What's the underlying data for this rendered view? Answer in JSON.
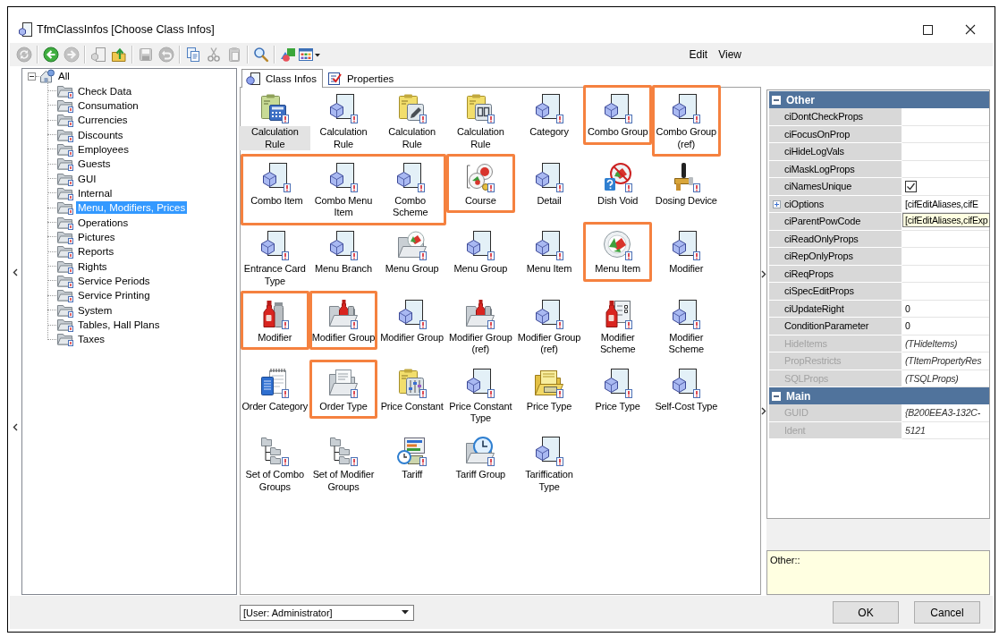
{
  "window": {
    "title": "TfmClassInfos [Choose Class Infos]"
  },
  "toolbar": [
    {
      "buttons": [
        {
          "kind": "refresh",
          "disabled": true
        }
      ]
    },
    {
      "buttons": [
        {
          "kind": "back",
          "disabled": false
        },
        {
          "kind": "forward",
          "disabled": true
        }
      ]
    },
    {
      "buttons": [
        {
          "kind": "document",
          "disabled": true
        },
        {
          "kind": "folderup",
          "disabled": false
        }
      ]
    },
    {
      "buttons": [
        {
          "kind": "save",
          "disabled": true
        },
        {
          "kind": "undo",
          "disabled": true
        }
      ]
    },
    {
      "buttons": [
        {
          "kind": "copy",
          "disabled": false
        },
        {
          "kind": "cut",
          "disabled": true
        },
        {
          "kind": "paste",
          "disabled": true
        }
      ]
    },
    {
      "buttons": [
        {
          "kind": "search",
          "disabled": false
        }
      ]
    },
    {
      "buttons": [
        {
          "kind": "shapes",
          "disabled": false
        },
        {
          "kind": "grid",
          "disabled": false
        }
      ]
    }
  ],
  "menu": [
    "Edit",
    "View"
  ],
  "tree": {
    "label": "All",
    "expanded": true,
    "selected": false,
    "children": [
      {
        "label": "Check Data",
        "selected": false
      },
      {
        "label": "Consumation",
        "selected": false
      },
      {
        "label": "Currencies",
        "selected": false
      },
      {
        "label": "Discounts",
        "selected": false
      },
      {
        "label": "Employees",
        "selected": false
      },
      {
        "label": "Guests",
        "selected": false
      },
      {
        "label": "GUI",
        "selected": false
      },
      {
        "label": "Internal",
        "selected": false
      },
      {
        "label": "Menu, Modifiers, Prices",
        "selected": true
      },
      {
        "label": "Operations",
        "selected": false
      },
      {
        "label": "Pictures",
        "selected": false
      },
      {
        "label": "Reports",
        "selected": false
      },
      {
        "label": "Rights",
        "selected": false
      },
      {
        "label": "Service Periods",
        "selected": false
      },
      {
        "label": "Service Printing",
        "selected": false
      },
      {
        "label": "System",
        "selected": false
      },
      {
        "label": "Tables, Hall Plans",
        "selected": false
      },
      {
        "label": "Taxes",
        "selected": false
      }
    ]
  },
  "tabs": [
    {
      "label": "Class Infos",
      "kind": "classes",
      "selected": true
    },
    {
      "label": "Properties",
      "kind": "properties",
      "selected": false
    }
  ],
  "class_grid": {
    "rows": [
      {
        "groups": [
          {
            "highlighted": false,
            "items": [
              {
                "kind": "calculator",
                "label": "Calculation Rule",
                "selected": true
              },
              {
                "kind": "document",
                "label": "Calculation Rule",
                "selected": false
              },
              {
                "kind": "pencil",
                "label": "Calculation Rule",
                "selected": false
              },
              {
                "kind": "counter",
                "label": "Calculation Rule",
                "selected": false
              },
              {
                "kind": "document",
                "label": "Category",
                "selected": false
              }
            ]
          },
          {
            "highlighted": true,
            "items": [
              {
                "kind": "document",
                "label": "Combo Group",
                "selected": false
              }
            ]
          },
          {
            "highlighted": true,
            "items": [
              {
                "kind": "document",
                "label": "Combo Group (ref)",
                "selected": false
              }
            ]
          }
        ]
      },
      {
        "groups": [
          {
            "highlighted": true,
            "items": [
              {
                "kind": "document",
                "label": "Combo Item",
                "selected": false
              },
              {
                "kind": "document",
                "label": "Combo Menu Item",
                "selected": false
              },
              {
                "kind": "document",
                "label": "Combo Scheme",
                "selected": false
              }
            ]
          },
          {
            "highlighted": true,
            "items": [
              {
                "kind": "course",
                "label": "Course",
                "selected": false
              }
            ]
          },
          {
            "highlighted": false,
            "items": [
              {
                "kind": "document",
                "label": "Detail",
                "selected": false
              },
              {
                "kind": "void",
                "label": "Dish Void",
                "selected": false
              },
              {
                "kind": "tap",
                "label": "Dosing Device",
                "selected": false
              }
            ]
          }
        ]
      },
      {
        "groups": [
          {
            "highlighted": false,
            "items": [
              {
                "kind": "document",
                "label": "Entrance Card Type",
                "selected": false
              },
              {
                "kind": "document",
                "label": "Menu Branch",
                "selected": false
              },
              {
                "kind": "dishfolder",
                "label": "Menu Group",
                "selected": false
              },
              {
                "kind": "document",
                "label": "Menu Group",
                "selected": false
              },
              {
                "kind": "document",
                "label": "Menu Item",
                "selected": false
              }
            ]
          },
          {
            "highlighted": true,
            "items": [
              {
                "kind": "dish",
                "label": "Menu Item",
                "selected": false
              }
            ]
          },
          {
            "highlighted": false,
            "items": [
              {
                "kind": "document",
                "label": "Modifier",
                "selected": false
              }
            ]
          }
        ]
      },
      {
        "groups": [
          {
            "highlighted": true,
            "items": [
              {
                "kind": "bottle",
                "label": "Modifier",
                "selected": false
              }
            ]
          },
          {
            "highlighted": true,
            "items": [
              {
                "kind": "bottlefolder",
                "label": "Modifier Group",
                "selected": false
              }
            ]
          },
          {
            "highlighted": false,
            "items": [
              {
                "kind": "document",
                "label": "Modifier Group",
                "selected": false
              },
              {
                "kind": "bottlefolder",
                "label": "Modifier Group (ref)",
                "selected": false
              },
              {
                "kind": "document",
                "label": "Modifier Group (ref)",
                "selected": false
              },
              {
                "kind": "bottlelist",
                "label": "Modifier Scheme",
                "selected": false
              },
              {
                "kind": "document",
                "label": "Modifier Scheme",
                "selected": false
              }
            ]
          }
        ]
      },
      {
        "groups": [
          {
            "highlighted": false,
            "items": [
              {
                "kind": "notebook",
                "label": "Order Category",
                "selected": false
              }
            ]
          },
          {
            "highlighted": true,
            "items": [
              {
                "kind": "docfolder",
                "label": "Order Type",
                "selected": false
              }
            ]
          },
          {
            "highlighted": false,
            "items": [
              {
                "kind": "sliders",
                "label": "Price Constant",
                "selected": false
              },
              {
                "kind": "document",
                "label": "Price Constant Type",
                "selected": false
              },
              {
                "kind": "moneyfolder",
                "label": "Price Type",
                "selected": false
              },
              {
                "kind": "document",
                "label": "Price Type",
                "selected": false
              },
              {
                "kind": "document",
                "label": "Self-Cost Type",
                "selected": false
              }
            ]
          }
        ]
      },
      {
        "groups": [
          {
            "highlighted": false,
            "items": [
              {
                "kind": "foldertree",
                "label": "Set of Combo Groups",
                "selected": false
              },
              {
                "kind": "foldertree",
                "label": "Set of Modifier Groups",
                "selected": false
              },
              {
                "kind": "tariff",
                "label": "Tariff",
                "selected": false
              },
              {
                "kind": "clockfolder",
                "label": "Tariff Group",
                "selected": false
              },
              {
                "kind": "document",
                "label": "Tariffication Type",
                "selected": false
              }
            ]
          }
        ]
      }
    ]
  },
  "property_grid": {
    "sections": [
      {
        "title": "Other",
        "expanded": true,
        "rows": [
          {
            "name": "ciDontCheckProps",
            "kind": "text",
            "readonly": false
          },
          {
            "name": "ciFocusOnProp",
            "kind": "text",
            "readonly": false
          },
          {
            "name": "ciHideLogVals",
            "kind": "text",
            "readonly": false
          },
          {
            "name": "ciMaskLogProps",
            "kind": "text",
            "readonly": false
          },
          {
            "name": "ciNamesUnique",
            "kind": "checkbox",
            "checked": true,
            "readonly": false
          },
          {
            "name": "ciOptions",
            "kind": "set",
            "expanded": false,
            "value": "[cifEditAliases,cifE",
            "tooltip": "[cifEditAliases,cifExp",
            "readonly": false
          },
          {
            "name": "ciParentPowCode",
            "kind": "text",
            "readonly": false
          },
          {
            "name": "ciReadOnlyProps",
            "kind": "text",
            "readonly": false
          },
          {
            "name": "ciRepOnlyProps",
            "kind": "text",
            "readonly": false
          },
          {
            "name": "ciReqProps",
            "kind": "text",
            "readonly": false
          },
          {
            "name": "ciSpecEditProps",
            "kind": "text",
            "readonly": false
          },
          {
            "name": "ciUpdateRight",
            "kind": "text",
            "value": "0",
            "readonly": false
          },
          {
            "name": "ConditionParameter",
            "kind": "text",
            "value": "0",
            "readonly": false
          },
          {
            "name": "HideItems",
            "kind": "text",
            "value": "(THideItems)",
            "readonly": true
          },
          {
            "name": "PropRestricts",
            "kind": "text",
            "value": "(TItemPropertyRes",
            "readonly": true
          },
          {
            "name": "SQLProps",
            "kind": "text",
            "value": "(TSQLProps)",
            "readonly": true
          }
        ]
      },
      {
        "title": "Main",
        "expanded": true,
        "rows": [
          {
            "name": "GUID",
            "kind": "text",
            "value": "{B200EEA3-132C-",
            "readonly": true
          },
          {
            "name": "Ident",
            "kind": "text",
            "value": "5121",
            "readonly": true
          }
        ]
      }
    ]
  },
  "description": "Other::",
  "user_combo": {
    "value": "[User: Administrator]"
  },
  "buttons": [
    "OK",
    "Cancel"
  ]
}
